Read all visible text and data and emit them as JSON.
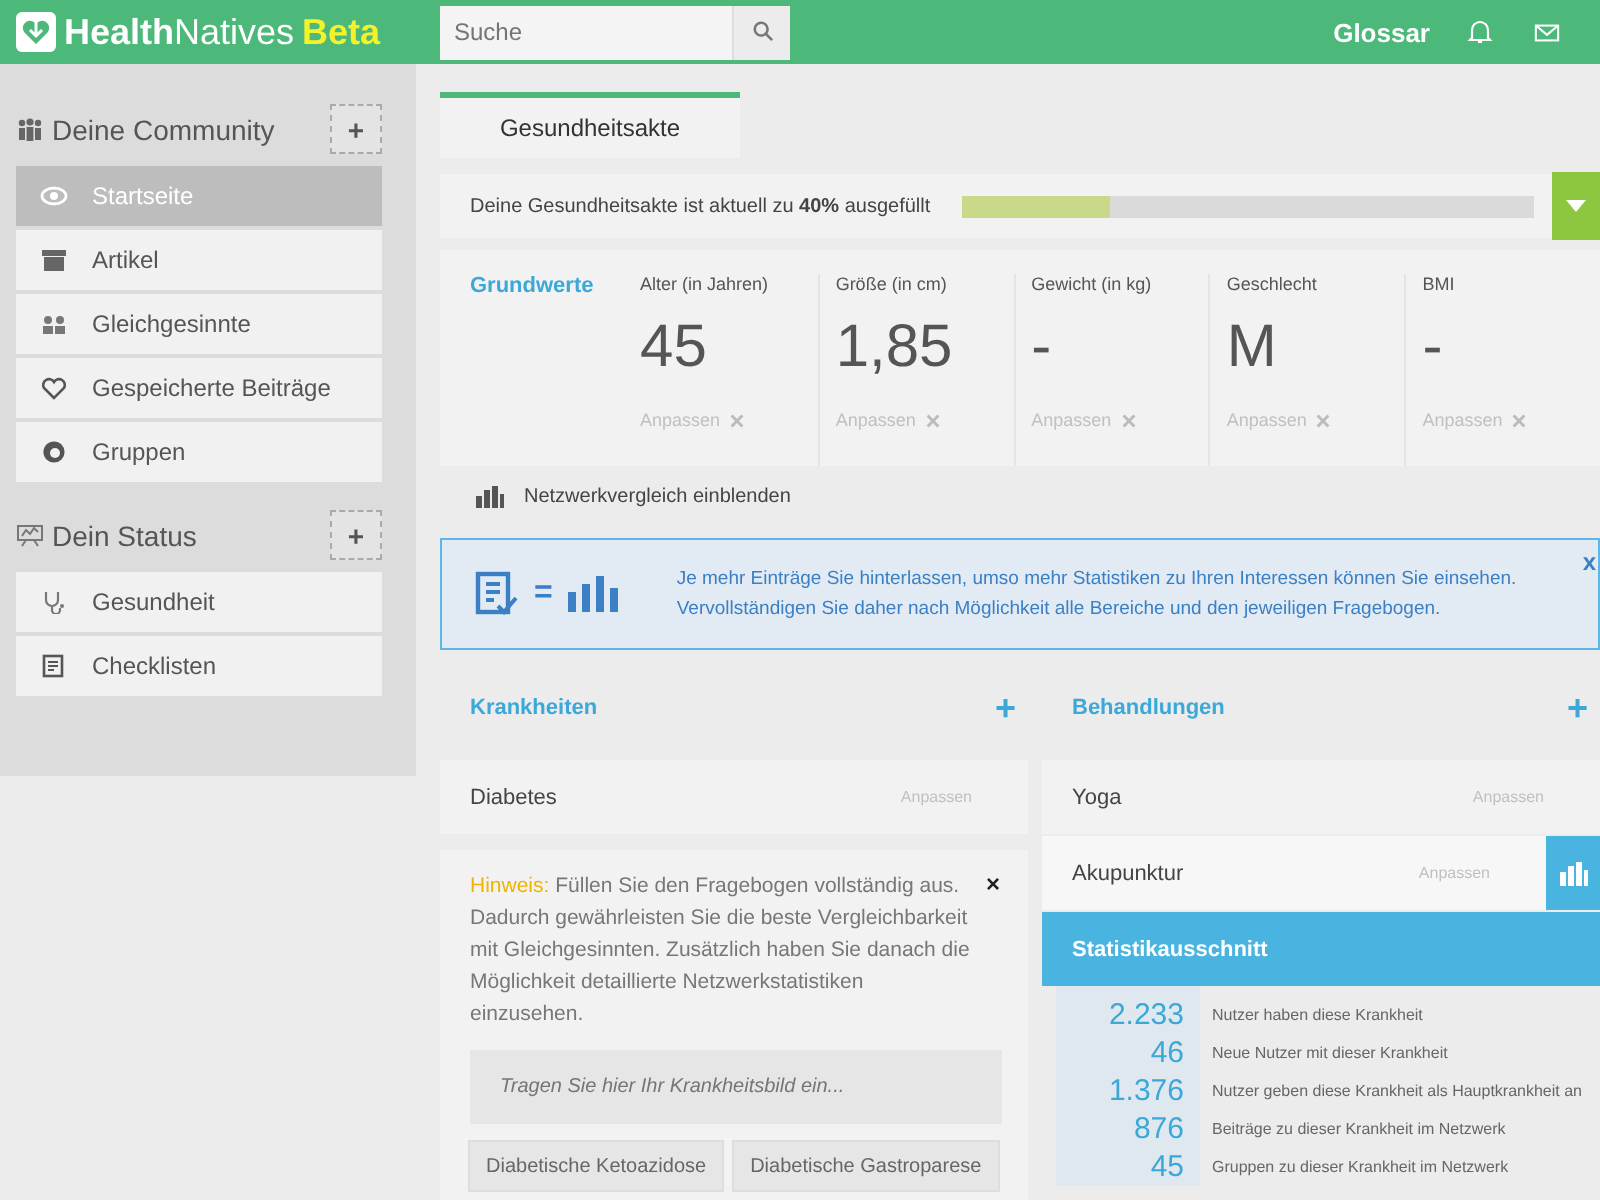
{
  "header": {
    "brand_bold": "Health",
    "brand_light": "Natives",
    "brand_badge": "Beta",
    "search": {
      "placeholder": "Suche"
    },
    "nav_link": "Glossar"
  },
  "sidebar": {
    "sections": [
      {
        "title": "Deine Community",
        "add": "+",
        "items": [
          {
            "label": "Startseite",
            "selected": true
          },
          {
            "label": "Artikel",
            "selected": false
          },
          {
            "label": "Gleichgesinnte",
            "selected": false
          },
          {
            "label": "Gespeicherte Beiträge",
            "selected": false
          },
          {
            "label": "Gruppen",
            "selected": false
          }
        ]
      },
      {
        "title": "Dein Status",
        "add": "+",
        "items": [
          {
            "label": "Gesundheit",
            "selected": false
          },
          {
            "label": "Checklisten",
            "selected": false
          }
        ]
      }
    ]
  },
  "tabs": [
    {
      "label": "Gesundheitsakte",
      "selected": true
    }
  ],
  "progress": {
    "text": "Deine Gesundheitsakte ist aktuell zu **40%** ausgefüllt",
    "level": 0.26
  },
  "grundwerte": {
    "title": "Grundwerte",
    "fields": [
      {
        "label": "Alter (in Jahren)",
        "value": "45",
        "action": "Anpassen"
      },
      {
        "label": "Größe (in cm)",
        "value": "1,85",
        "action": "Anpassen"
      },
      {
        "label": "Gewicht (in kg)",
        "value": "-",
        "action": "Anpassen"
      },
      {
        "label": "Geschlecht",
        "value": "M",
        "action": "Anpassen"
      },
      {
        "label": "BMI",
        "value": "-",
        "action": "Anpassen"
      }
    ]
  },
  "network_toggle": "Netzwerkvergleich einblenden",
  "banner": {
    "equals": "=",
    "text": "Je mehr Einträge Sie hinterlassen, umso mehr Statistiken zu Ihren Interessen können Sie einsehen. Vervollständigen Sie daher nach Möglichkeit alle Bereiche und den jeweiligen Fragebogen.",
    "close": "x"
  },
  "krankheiten": {
    "title": "Krankheiten",
    "add": "+",
    "items": [
      {
        "label": "Diabetes",
        "action": "Anpassen"
      }
    ],
    "hint": {
      "text": "**Hinweis:** Füllen Sie den Fragebogen vollständig aus. Dadurch gewährleisten Sie die beste Vergleichbarkeit mit Gleichgesinnten. Zusätzlich haben Sie danach die Möglichkeit detaillierte Netzwerkstatistiken einzusehen.",
      "close": "×",
      "input": {
        "placeholder": "Tragen Sie hier Ihr Krankheitsbild ein..."
      },
      "tags": [
        "Diabetische Ketoazidose",
        "Diabetische Gastroparese"
      ]
    }
  },
  "behandlungen": {
    "title": "Behandlungen",
    "add": "+",
    "items": [
      {
        "label": "Yoga",
        "action": "Anpassen",
        "selected": false
      },
      {
        "label": "Akupunktur",
        "action": "Anpassen",
        "selected": true
      }
    ],
    "stats": {
      "title": "Statistikausschnitt",
      "rows": [
        {
          "value": "2.233",
          "label": "Nutzer haben diese Krankheit"
        },
        {
          "value": "46",
          "label": "Neue Nutzer mit dieser Krankheit"
        },
        {
          "value": "1.376",
          "label": "Nutzer geben diese Krankheit als Hauptkrankheit an"
        },
        {
          "value": "876",
          "label": "Beiträge zu dieser Krankheit im Netzwerk"
        },
        {
          "value": "45",
          "label": "Gruppen zu dieser Krankheit im Netzwerk"
        }
      ]
    }
  }
}
